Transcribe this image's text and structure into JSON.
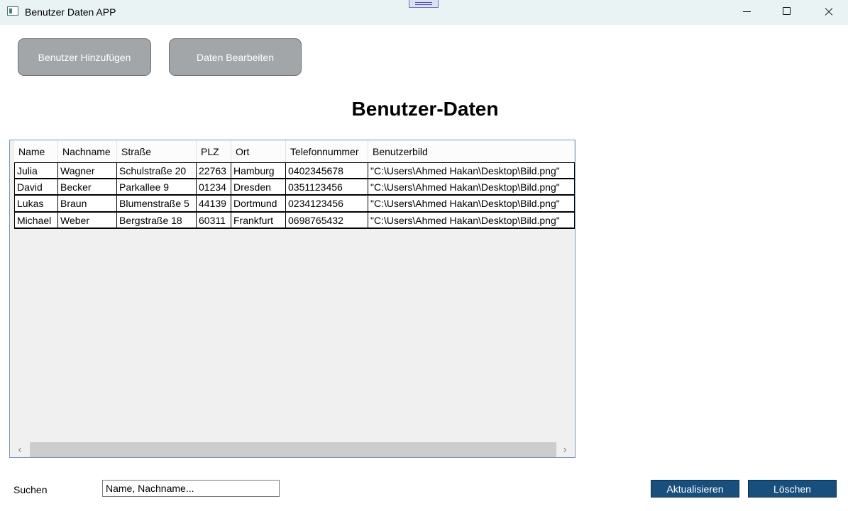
{
  "window": {
    "title": "Benutzer Daten APP"
  },
  "toolbar": {
    "add_label": "Benutzer Hinzufügen",
    "edit_label": "Daten Bearbeiten"
  },
  "main": {
    "title": "Benutzer-Daten"
  },
  "table": {
    "columns": [
      "Name",
      "Nachname",
      "Straße",
      "PLZ",
      "Ort",
      "Telefonnummer",
      "Benutzerbild"
    ],
    "rows": [
      [
        "Julia",
        "Wagner",
        "Schulstraße 20",
        "22763",
        "Hamburg",
        "0402345678",
        "\"C:\\Users\\Ahmed Hakan\\Desktop\\Bild.png\""
      ],
      [
        "David",
        "Becker",
        "Parkallee 9",
        "01234",
        "Dresden",
        "0351123456",
        "\"C:\\Users\\Ahmed Hakan\\Desktop\\Bild.png\""
      ],
      [
        "Lukas",
        "Braun",
        "Blumenstraße 5",
        "44139",
        "Dortmund",
        "0234123456",
        "\"C:\\Users\\Ahmed Hakan\\Desktop\\Bild.png\""
      ],
      [
        "Michael",
        "Weber",
        "Bergstraße 18",
        "60311",
        "Frankfurt",
        "0698765432",
        "\"C:\\Users\\Ahmed Hakan\\Desktop\\Bild.png\""
      ]
    ]
  },
  "search": {
    "label": "Suchen",
    "placeholder": "Name, Nachname..."
  },
  "footer": {
    "refresh_label": "Aktualisieren",
    "delete_label": "Löschen"
  },
  "colors": {
    "accent": "#194f7d",
    "button_gray": "#a2a6a9",
    "titlebar": "#e9f3f3"
  },
  "icons": {
    "app": "app-window-icon",
    "minimize": "minimize-icon",
    "maximize": "maximize-icon",
    "close": "close-icon"
  }
}
